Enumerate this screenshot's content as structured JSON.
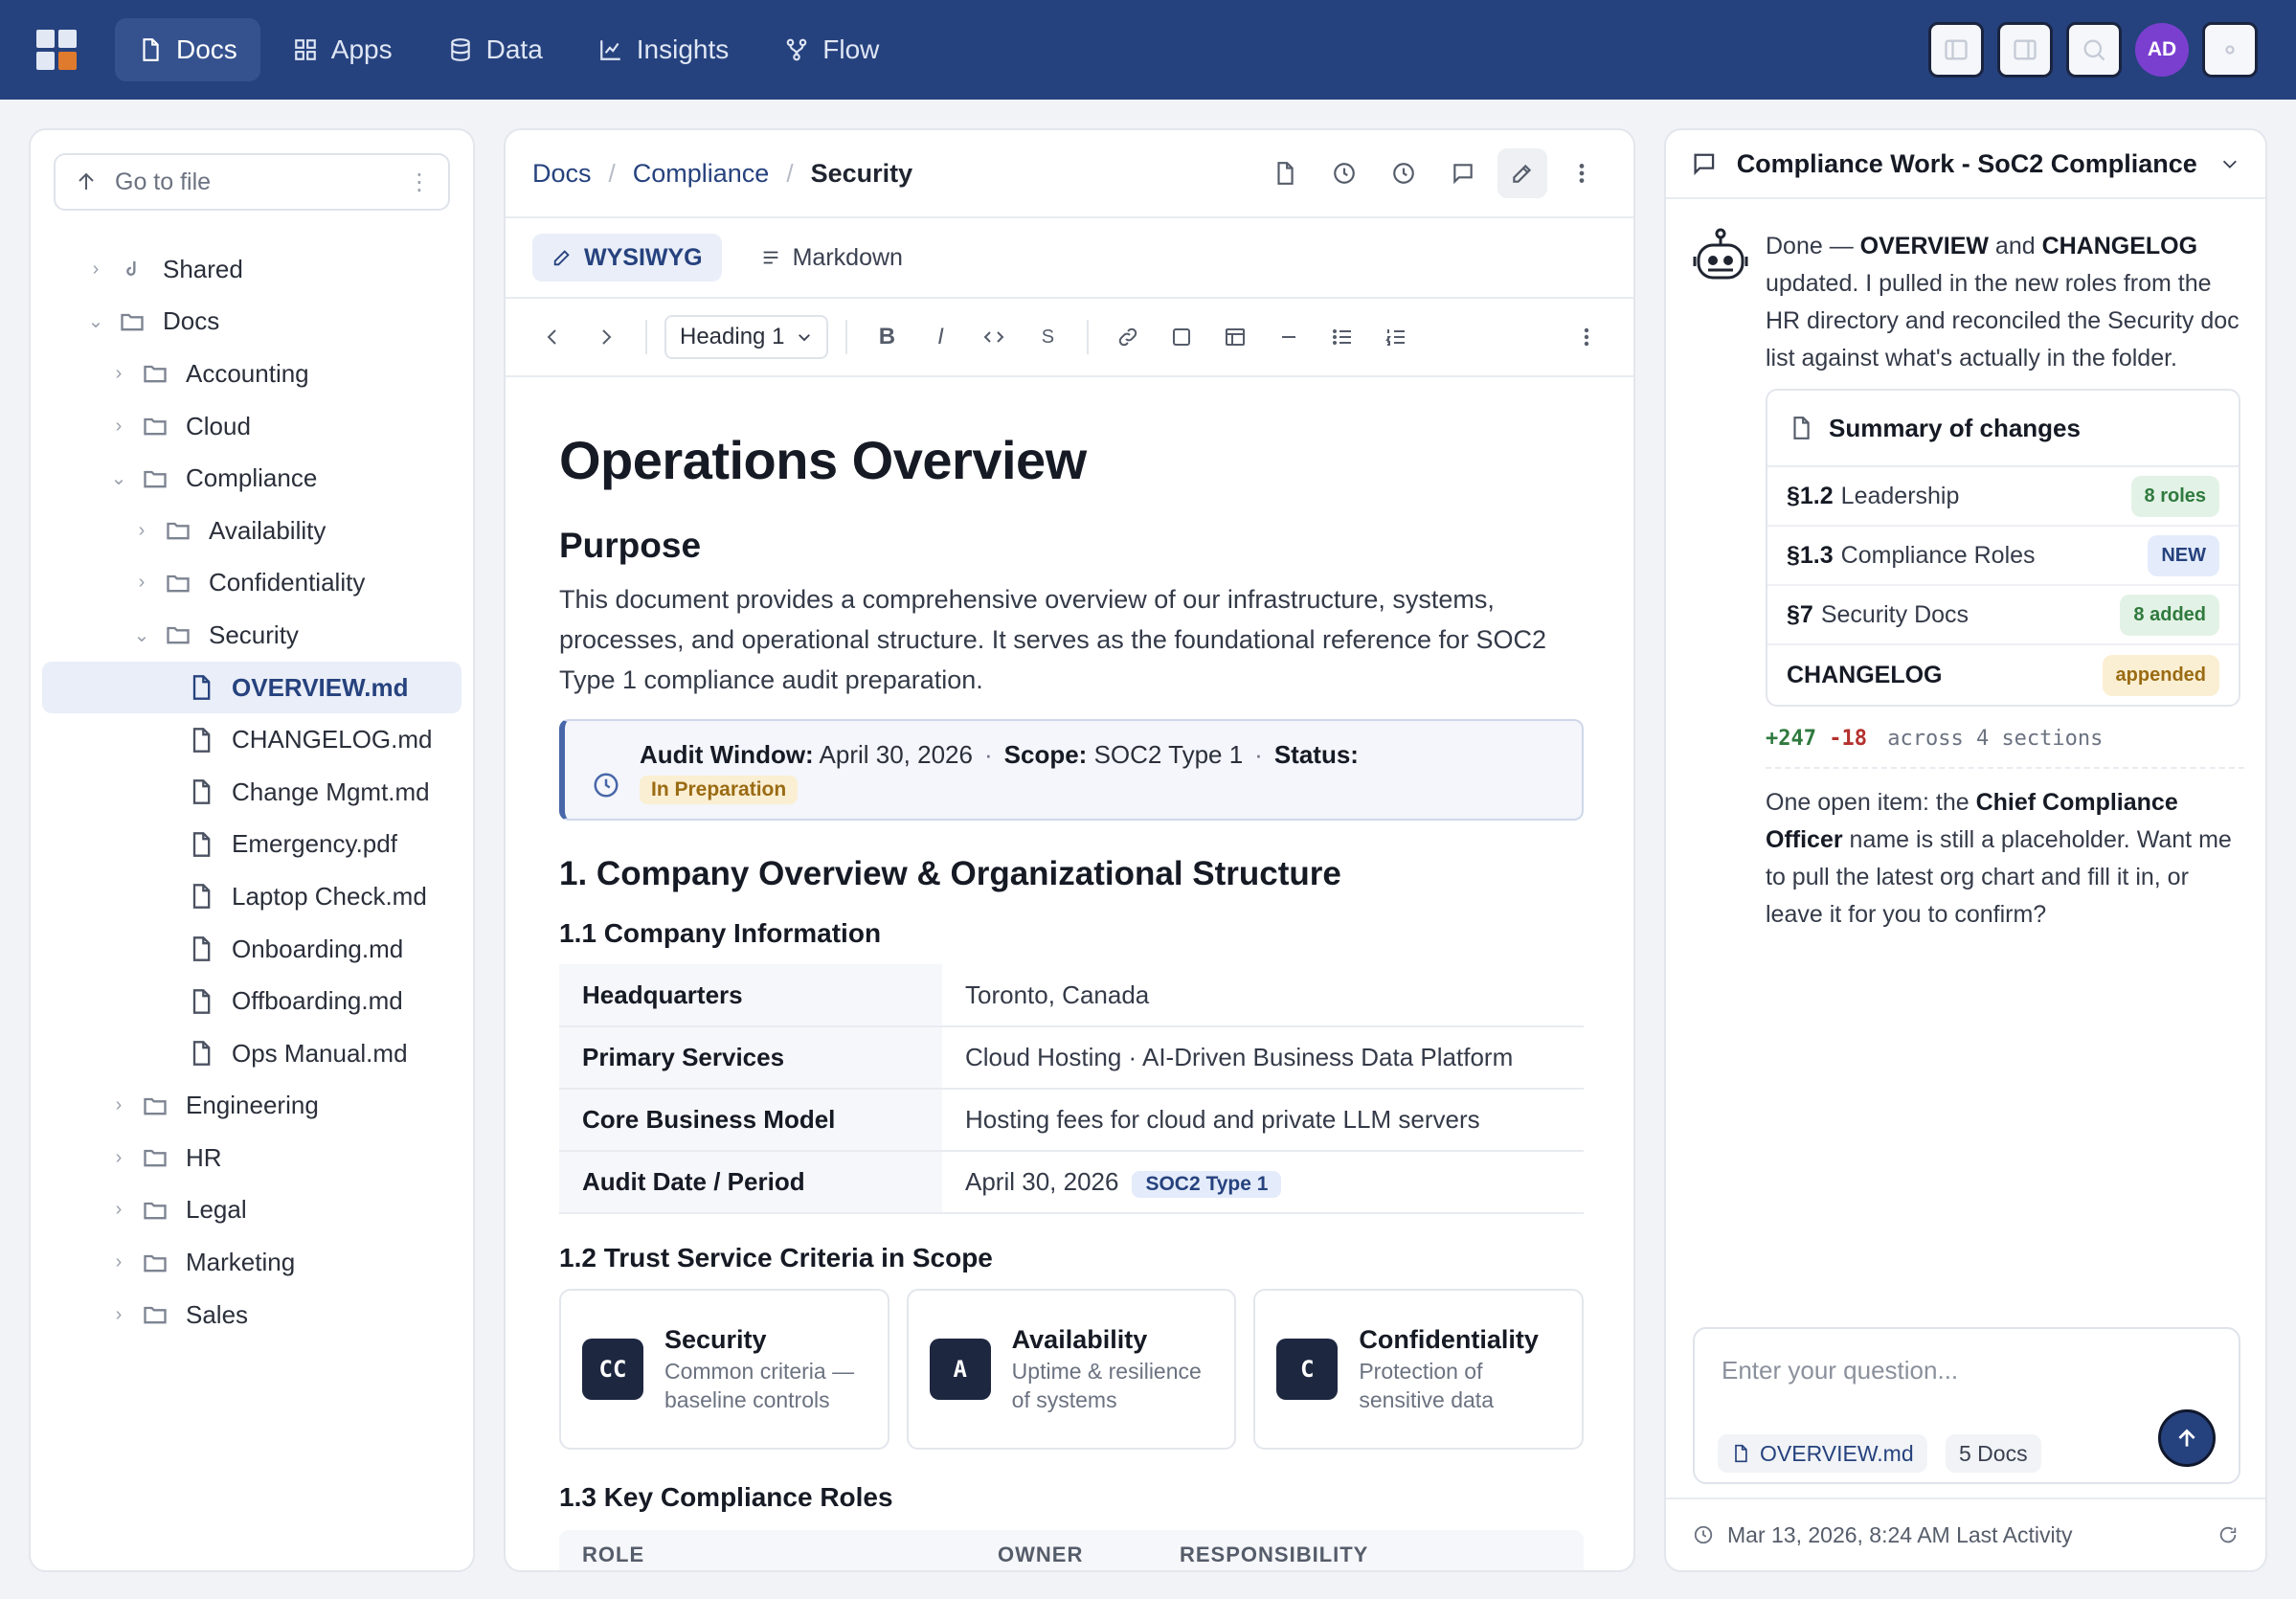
{
  "nav": {
    "tabs": [
      {
        "label": "Docs",
        "icon": "document-icon",
        "active": true
      },
      {
        "label": "Apps",
        "icon": "grid-icon"
      },
      {
        "label": "Data",
        "icon": "database-icon"
      },
      {
        "label": "Insights",
        "icon": "chart-line-icon"
      },
      {
        "label": "Flow",
        "icon": "flow-icon"
      }
    ],
    "avatar_initials": "AD"
  },
  "sidebar": {
    "search_placeholder": "Go to file",
    "tree": [
      {
        "label": "Shared",
        "type": "folder",
        "depth": 0,
        "expanded": false,
        "icon": "shared-icon"
      },
      {
        "label": "Docs",
        "type": "folder",
        "depth": 0,
        "expanded": true
      },
      {
        "label": "Accounting",
        "type": "folder",
        "depth": 1,
        "expanded": false
      },
      {
        "label": "Cloud",
        "type": "folder",
        "depth": 1,
        "expanded": false
      },
      {
        "label": "Compliance",
        "type": "folder",
        "depth": 1,
        "expanded": true
      },
      {
        "label": "Availability",
        "type": "folder",
        "depth": 2,
        "expanded": false
      },
      {
        "label": "Confidentiality",
        "type": "folder",
        "depth": 2,
        "expanded": false
      },
      {
        "label": "Security",
        "type": "folder",
        "depth": 2,
        "expanded": true
      },
      {
        "label": "OVERVIEW.md",
        "type": "file",
        "depth": 3,
        "selected": true
      },
      {
        "label": "CHANGELOG.md",
        "type": "file",
        "depth": 3
      },
      {
        "label": "Change Mgmt.md",
        "type": "file",
        "depth": 3
      },
      {
        "label": "Emergency.pdf",
        "type": "file",
        "depth": 3
      },
      {
        "label": "Laptop Check.md",
        "type": "file",
        "depth": 3
      },
      {
        "label": "Onboarding.md",
        "type": "file",
        "depth": 3
      },
      {
        "label": "Offboarding.md",
        "type": "file",
        "depth": 3
      },
      {
        "label": "Ops Manual.md",
        "type": "file",
        "depth": 3
      },
      {
        "label": "Engineering",
        "type": "folder",
        "depth": 1,
        "expanded": false
      },
      {
        "label": "HR",
        "type": "folder",
        "depth": 1,
        "expanded": false
      },
      {
        "label": "Legal",
        "type": "folder",
        "depth": 1,
        "expanded": false
      },
      {
        "label": "Marketing",
        "type": "folder",
        "depth": 1,
        "expanded": false
      },
      {
        "label": "Sales",
        "type": "folder",
        "depth": 1,
        "expanded": false
      }
    ]
  },
  "editor": {
    "breadcrumb": [
      "Docs",
      "Compliance",
      "Security"
    ],
    "modes": {
      "wysiwyg": "WYSIWYG",
      "markdown": "Markdown"
    },
    "heading_select": "Heading 1",
    "doc": {
      "title": "Operations Overview",
      "purpose_heading": "Purpose",
      "purpose_text": "This document provides a comprehensive overview of our infrastructure, systems, processes, and operational structure. It serves as the foundational reference for SOC2 Type 1 compliance audit preparation.",
      "callout": {
        "audit_label": "Audit Window:",
        "audit_value": "April 30, 2026",
        "scope_label": "Scope:",
        "scope_value": "SOC2 Type 1",
        "status_label": "Status:",
        "status_value": "In Preparation"
      },
      "section1": "1. Company Overview & Organizational Structure",
      "section1_1": "1.1 Company Information",
      "company_info": [
        {
          "k": "Headquarters",
          "v": "Toronto, Canada"
        },
        {
          "k": "Primary Services",
          "v": "Cloud Hosting · AI-Driven Business Data Platform"
        },
        {
          "k": "Core Business Model",
          "v": "Hosting fees for cloud and private LLM servers"
        },
        {
          "k": "Audit Date / Period",
          "v": "April 30, 2026",
          "badge": "SOC2 Type 1"
        }
      ],
      "section1_2": "1.2 Trust Service Criteria in Scope",
      "criteria": [
        {
          "code": "CC",
          "title": "Security",
          "desc": "Common criteria — baseline controls"
        },
        {
          "code": "A",
          "title": "Availability",
          "desc": "Uptime & resilience of systems"
        },
        {
          "code": "C",
          "title": "Confidentiality",
          "desc": "Protection of sensitive data"
        }
      ],
      "section1_3": "1.3 Key Compliance Roles",
      "roles_columns": [
        "ROLE",
        "OWNER",
        "RESPONSIBILITY"
      ]
    }
  },
  "chat": {
    "title": "Compliance Work - SoC2 Compliance",
    "msg1": {
      "p1": "Done — ",
      "b1": "OVERVIEW",
      "p2": " and ",
      "b2": "CHANGELOG",
      "p3": " updated. I pulled in the new roles from the HR directory and reconciled the Security doc list against what's actually in the folder."
    },
    "summary_title": "Summary of changes",
    "summary": [
      {
        "ref": "§1.2",
        "label": "Leadership",
        "pill": "8 roles",
        "tone": "green"
      },
      {
        "ref": "§1.3",
        "label": "Compliance Roles",
        "pill": "NEW",
        "tone": "blue"
      },
      {
        "ref": "§7",
        "label": "Security Docs",
        "pill": "8 added",
        "tone": "green"
      },
      {
        "ref": "CHANGELOG",
        "label": "",
        "pill": "appended",
        "tone": "amber"
      }
    ],
    "diff": {
      "plus": "+247",
      "minus": "-18",
      "text": "across 4 sections"
    },
    "msg2": {
      "p1": "One open item: the ",
      "b1": "Chief Compliance Officer",
      "p2": " name is still a placeholder. Want me to pull the latest org chart and fill it in, or leave it for you to confirm?"
    },
    "input_placeholder": "Enter your question...",
    "chip_file": "OVERVIEW.md",
    "chip_docs": "5 Docs",
    "footer": "Mar 13, 2026, 8:24 AM Last Activity"
  }
}
